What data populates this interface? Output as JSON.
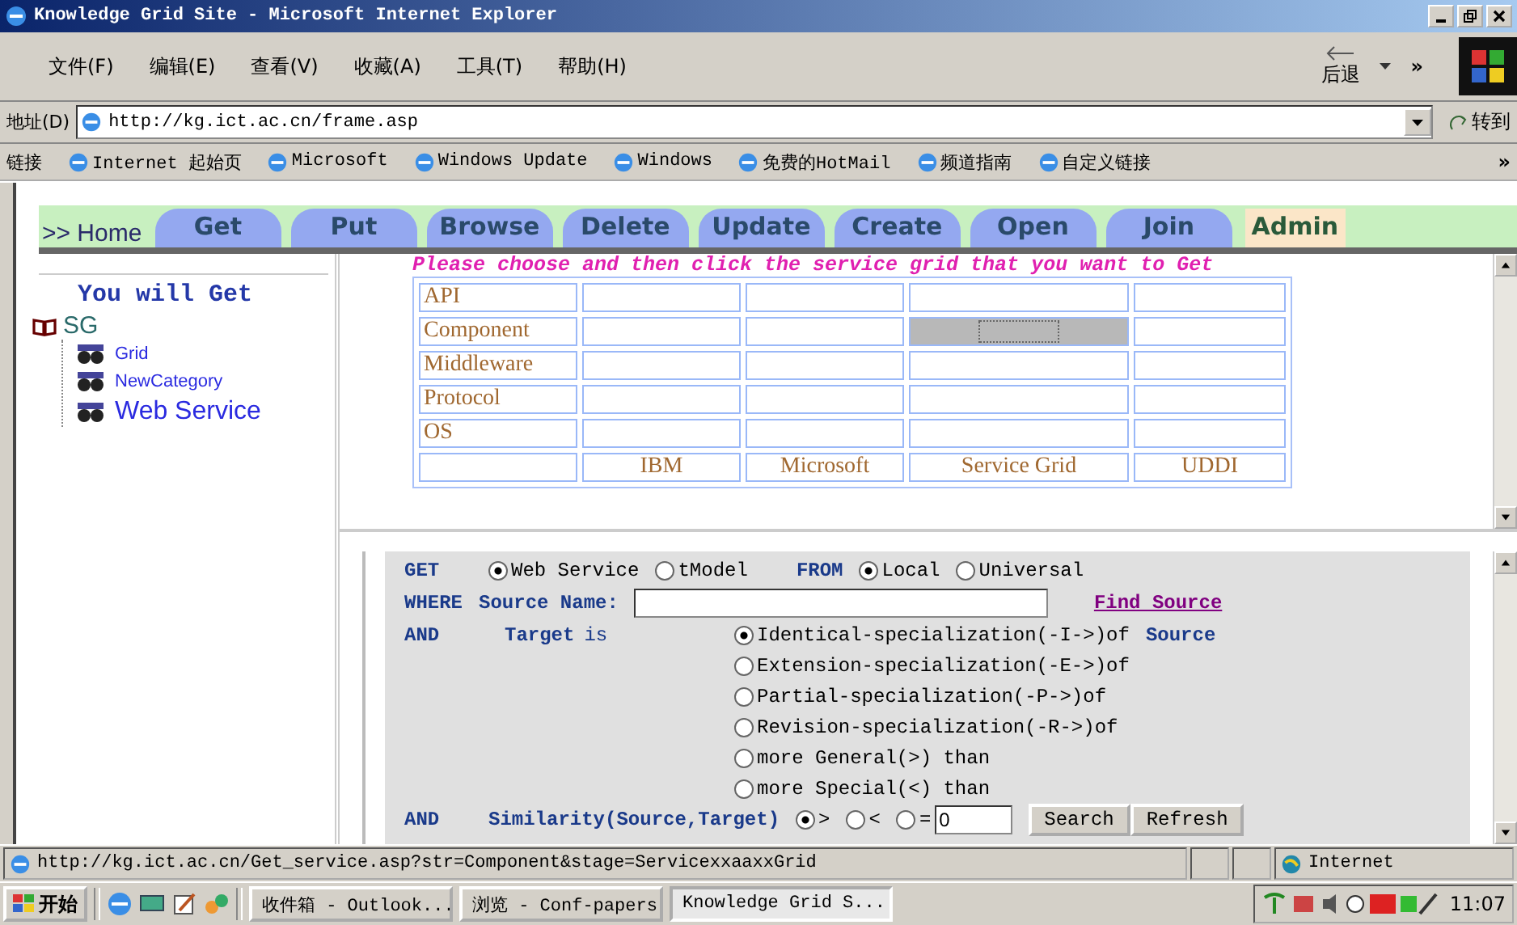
{
  "window": {
    "title": "Knowledge Grid Site - Microsoft Internet Explorer"
  },
  "menu": [
    "文件(F)",
    "编辑(E)",
    "查看(V)",
    "收藏(A)",
    "工具(T)",
    "帮助(H)"
  ],
  "toolbar": {
    "back": "后退",
    "more": "»"
  },
  "address": {
    "label": "地址(D)",
    "url": "http://kg.ict.ac.cn/frame.asp",
    "go": "转到"
  },
  "links": {
    "label": "链接",
    "items": [
      "Internet 起始页",
      "Microsoft",
      "Windows Update",
      "Windows",
      "免费的HotMail",
      "频道指南",
      "自定义链接"
    ],
    "more": "»"
  },
  "nav": {
    "home": ">> Home",
    "tabs": [
      {
        "label": "Get",
        "kind": "tab"
      },
      {
        "label": "Put",
        "kind": "tab"
      },
      {
        "label": "Browse",
        "kind": "tab"
      },
      {
        "label": "Delete",
        "kind": "tab"
      },
      {
        "label": "Update",
        "kind": "tab"
      },
      {
        "label": "Create",
        "kind": "tab"
      },
      {
        "label": "Open",
        "kind": "tab"
      },
      {
        "label": "Join",
        "kind": "tab"
      },
      {
        "label": "Admin",
        "kind": "admin"
      }
    ]
  },
  "sidebar": {
    "heading": "You will Get",
    "root": "SG",
    "children": [
      {
        "label": "Grid",
        "selected": false
      },
      {
        "label": "NewCategory",
        "selected": false
      },
      {
        "label": "Web Service",
        "selected": true
      }
    ]
  },
  "instruction": "Please choose and then click the service grid that you want to Get",
  "grid": {
    "rows": [
      {
        "label": "API",
        "cells": [
          {
            "selected": false
          },
          {
            "selected": false
          },
          {
            "selected": false
          },
          {
            "selected": false
          }
        ]
      },
      {
        "label": "Component",
        "cells": [
          {
            "selected": false
          },
          {
            "selected": false
          },
          {
            "selected": true
          },
          {
            "selected": false
          }
        ]
      },
      {
        "label": "Middleware",
        "cells": [
          {
            "selected": false
          },
          {
            "selected": false
          },
          {
            "selected": false
          },
          {
            "selected": false
          }
        ]
      },
      {
        "label": "Protocol",
        "cells": [
          {
            "selected": false
          },
          {
            "selected": false
          },
          {
            "selected": false
          },
          {
            "selected": false
          }
        ]
      },
      {
        "label": "OS",
        "cells": [
          {
            "selected": false
          },
          {
            "selected": false
          },
          {
            "selected": false
          },
          {
            "selected": false
          }
        ]
      }
    ],
    "columns": [
      "IBM",
      "Microsoft",
      "Service Grid",
      "UDDI"
    ]
  },
  "form": {
    "get_label": "GET",
    "get_options": [
      {
        "label": "Web Service",
        "selected": true
      },
      {
        "label": "tModel",
        "selected": false
      }
    ],
    "from_label": "FROM",
    "from_options": [
      {
        "label": "Local",
        "selected": true
      },
      {
        "label": "Universal",
        "selected": false
      }
    ],
    "where_label": "WHERE",
    "source_label": "Source Name:",
    "find_link": "Find Source",
    "and_label": "AND",
    "target_label": "Target",
    "target_is": "is",
    "source_word": "Source",
    "target_options": [
      {
        "label": "Identical-specialization(-I->)of",
        "selected": true
      },
      {
        "label": "Extension-specialization(-E->)of",
        "selected": false
      },
      {
        "label": "Partial-specialization(-P->)of",
        "selected": false
      },
      {
        "label": "Revision-specialization(-R->)of",
        "selected": false
      },
      {
        "label": "more General(>) than",
        "selected": false
      },
      {
        "label": "more Special(<) than",
        "selected": false
      }
    ],
    "and2_label": "AND",
    "similarity_label": "Similarity(Source,Target)",
    "similarity_options": [
      {
        "label": ">",
        "selected": true
      },
      {
        "label": "<",
        "selected": false
      },
      {
        "label": "=",
        "selected": false
      }
    ],
    "similarity_value": "0",
    "buttons": [
      "Search",
      "Refresh"
    ]
  },
  "status_bar": {
    "url": "http://kg.ict.ac.cn/Get_service.asp?str=Component&stage=ServicexxaaxxGrid",
    "zone": "Internet"
  },
  "taskbar": {
    "start": "开始",
    "tasks": [
      {
        "label": "收件箱 - Outlook...",
        "selected": false
      },
      {
        "label": "浏览 - Conf-papers",
        "selected": false
      },
      {
        "label": "Knowledge Grid S...",
        "selected": true
      }
    ],
    "time": "11:07"
  }
}
